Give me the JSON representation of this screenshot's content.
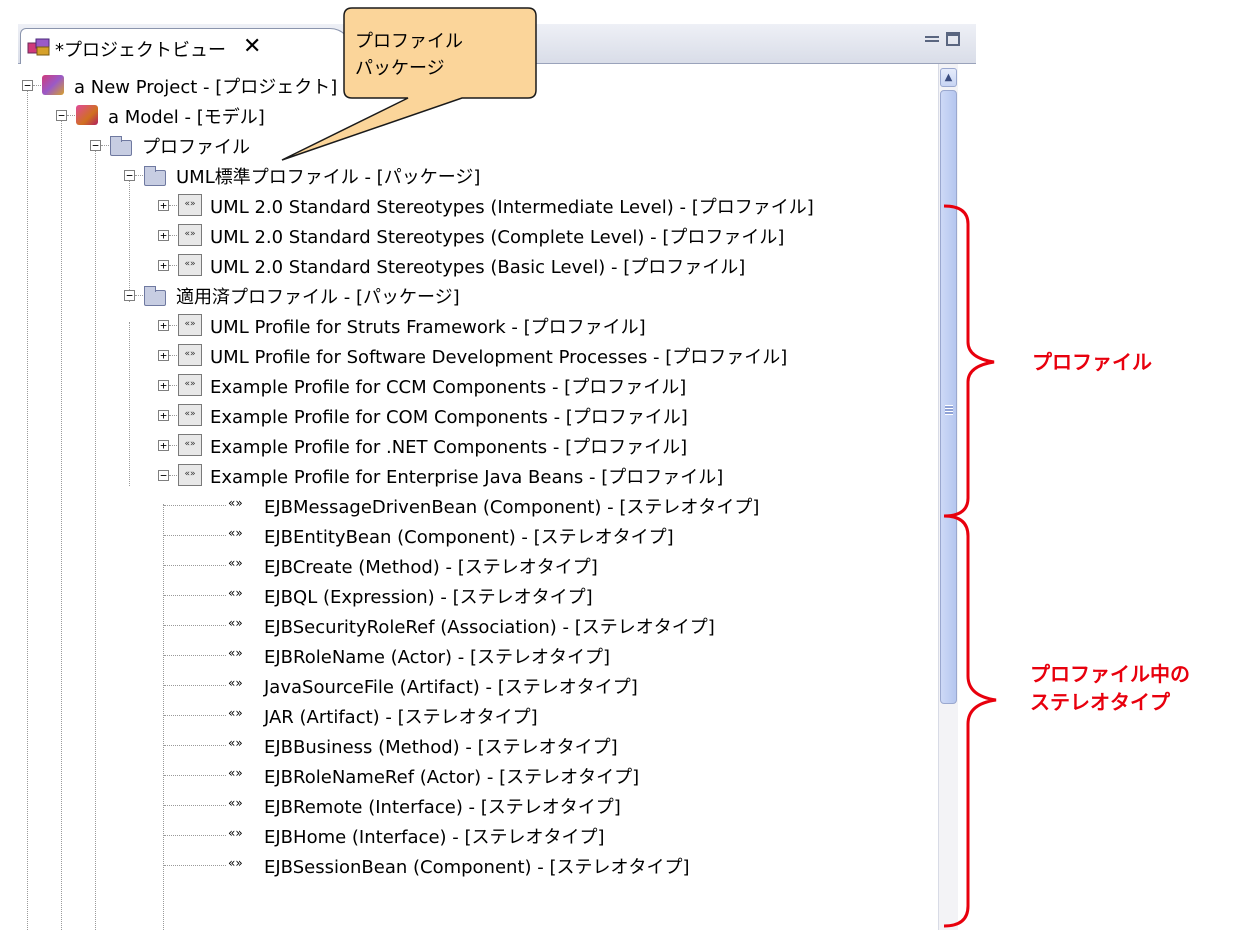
{
  "view": {
    "tab_title": "*プロジェクトビュー",
    "close_glyph": "✕",
    "tab_icon": "project-view-icon"
  },
  "callout": {
    "text": "プロファイル\nパッケージ",
    "fill": "#fbd59a"
  },
  "annotations": {
    "profiles": "プロファイル",
    "stereotypes": "プロファイル中の\nステレオタイプ",
    "color": "#e8000d"
  },
  "tree": [
    {
      "label": "a New Project - [プロジェクト]",
      "icon": "project-icon",
      "toggle": "−"
    },
    {
      "label": "a Model - [モデル]",
      "icon": "model-icon",
      "toggle": "−"
    },
    {
      "label": "プロファイル",
      "icon": "folder-icon",
      "toggle": "−"
    },
    {
      "label": "UML標準プロファイル - [パッケージ]",
      "icon": "folder-icon",
      "toggle": "−"
    },
    {
      "label": "UML 2.0 Standard Stereotypes (Intermediate Level) - [プロファイル]",
      "icon": "profile-icon",
      "toggle": "+"
    },
    {
      "label": "UML 2.0 Standard Stereotypes (Complete Level) - [プロファイル]",
      "icon": "profile-icon",
      "toggle": "+"
    },
    {
      "label": "UML 2.0 Standard Stereotypes (Basic Level) - [プロファイル]",
      "icon": "profile-icon",
      "toggle": "+"
    },
    {
      "label": "適用済プロファイル - [パッケージ]",
      "icon": "folder-icon",
      "toggle": "−"
    },
    {
      "label": "UML Profile for Struts Framework - [プロファイル]",
      "icon": "profile-icon",
      "toggle": "+"
    },
    {
      "label": "UML Profile for Software Development Processes - [プロファイル]",
      "icon": "profile-icon",
      "toggle": "+"
    },
    {
      "label": "Example Profile for CCM Components - [プロファイル]",
      "icon": "profile-icon",
      "toggle": "+"
    },
    {
      "label": "Example Profile for COM Components - [プロファイル]",
      "icon": "profile-icon",
      "toggle": "+"
    },
    {
      "label": "Example Profile for .NET Components - [プロファイル]",
      "icon": "profile-icon",
      "toggle": "+"
    },
    {
      "label": "Example Profile for Enterprise Java Beans - [プロファイル]",
      "icon": "profile-icon",
      "toggle": "−"
    },
    {
      "label": "EJBMessageDrivenBean (Component) - [ステレオタイプ]",
      "icon": "stereotype-icon"
    },
    {
      "label": "EJBEntityBean (Component) - [ステレオタイプ]",
      "icon": "stereotype-icon"
    },
    {
      "label": "EJBCreate (Method) - [ステレオタイプ]",
      "icon": "stereotype-icon"
    },
    {
      "label": "EJBQL (Expression) - [ステレオタイプ]",
      "icon": "stereotype-icon"
    },
    {
      "label": "EJBSecurityRoleRef (Association) - [ステレオタイプ]",
      "icon": "stereotype-icon"
    },
    {
      "label": "EJBRoleName (Actor) - [ステレオタイプ]",
      "icon": "stereotype-icon"
    },
    {
      "label": "JavaSourceFile (Artifact) - [ステレオタイプ]",
      "icon": "stereotype-icon"
    },
    {
      "label": "JAR (Artifact) - [ステレオタイプ]",
      "icon": "stereotype-icon"
    },
    {
      "label": "EJBBusiness (Method) - [ステレオタイプ]",
      "icon": "stereotype-icon"
    },
    {
      "label": "EJBRoleNameRef (Actor) - [ステレオタイプ]",
      "icon": "stereotype-icon"
    },
    {
      "label": "EJBRemote (Interface) - [ステレオタイプ]",
      "icon": "stereotype-icon"
    },
    {
      "label": "EJBHome (Interface) - [ステレオタイプ]",
      "icon": "stereotype-icon"
    },
    {
      "label": "EJBSessionBean (Component) - [ステレオタイプ]",
      "icon": "stereotype-icon"
    }
  ]
}
